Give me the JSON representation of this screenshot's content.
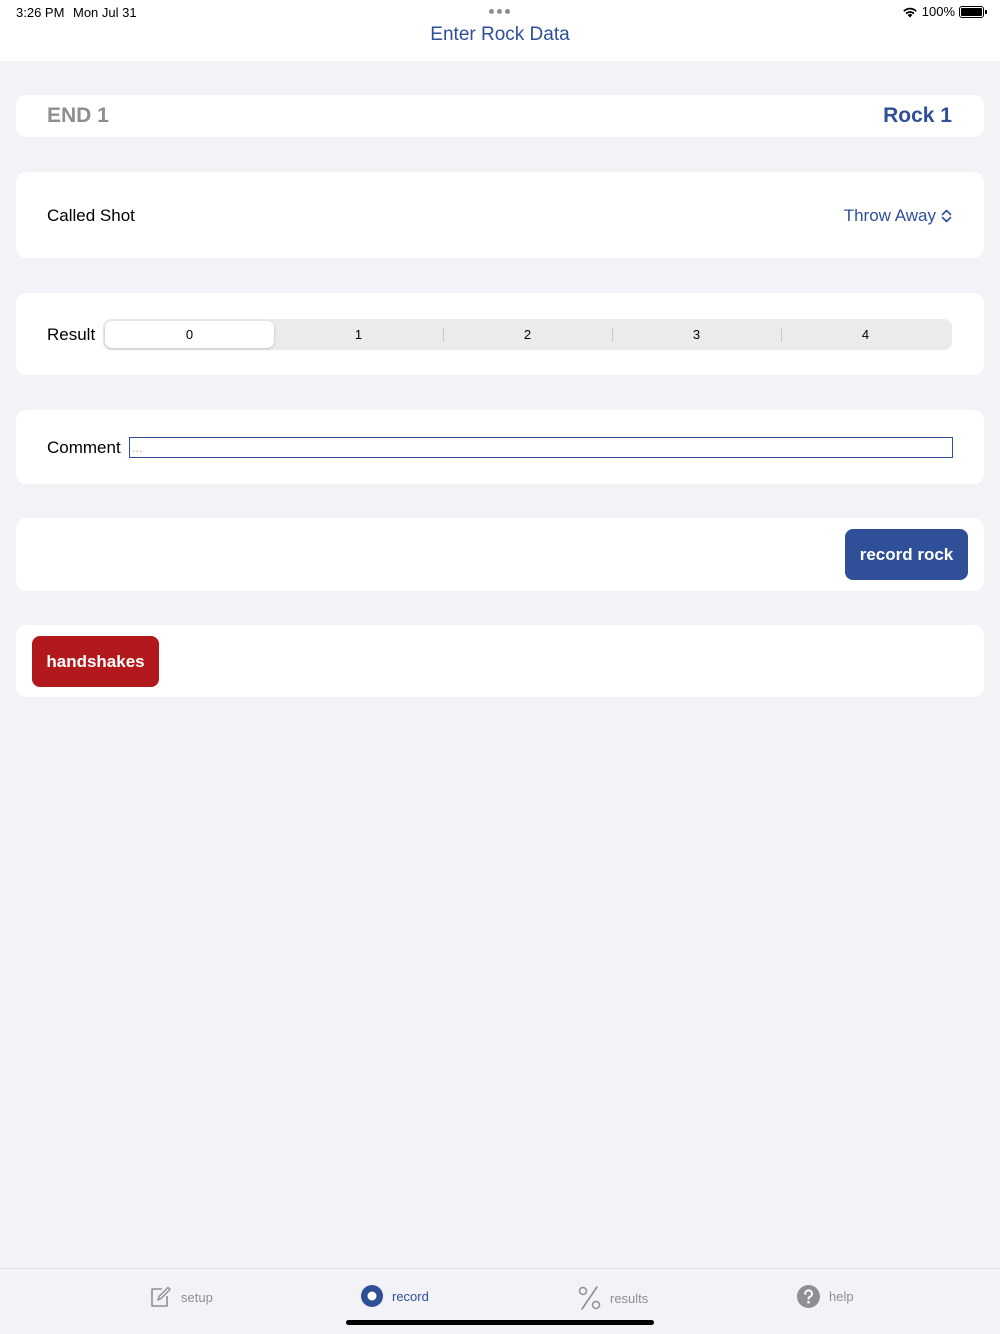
{
  "status": {
    "time": "3:26 PM",
    "date": "Mon Jul 31",
    "battery": "100%"
  },
  "nav": {
    "title": "Enter Rock Data"
  },
  "header": {
    "end_label": "END 1",
    "rock_label": "Rock 1"
  },
  "called_shot": {
    "label": "Called Shot",
    "value": "Throw Away"
  },
  "result": {
    "label": "Result",
    "options": [
      "0",
      "1",
      "2",
      "3",
      "4"
    ],
    "selected_index": 0
  },
  "comment": {
    "label": "Comment",
    "placeholder": "...",
    "value": ""
  },
  "actions": {
    "record_label": "record rock",
    "handshakes_label": "handshakes"
  },
  "tabs": [
    {
      "label": "setup",
      "icon": "edit-icon",
      "active": false
    },
    {
      "label": "record",
      "icon": "record-icon",
      "active": true
    },
    {
      "label": "results",
      "icon": "percent-icon",
      "active": false
    },
    {
      "label": "help",
      "icon": "help-icon",
      "active": false
    }
  ],
  "colors": {
    "accent": "#2f4f99",
    "danger": "#b2191c",
    "background": "#f2f2f7",
    "inactive": "#8e8e93"
  }
}
